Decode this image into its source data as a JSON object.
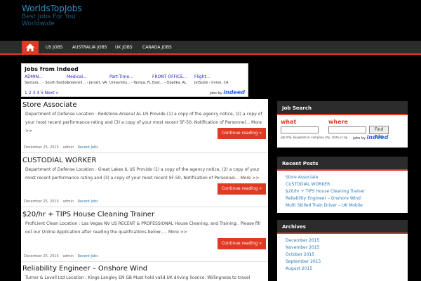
{
  "site": {
    "title": "WorldsTopJobs",
    "description": "Best Jobs For You Worldwide"
  },
  "nav": {
    "items": [
      "US JOBS",
      "AUSTRALIA JOBS",
      "UK JOBS",
      "CANADA JOBS"
    ]
  },
  "indeed_widget": {
    "heading": "Jobs from Indeed",
    "jobs": [
      {
        "title": "ADMIN...",
        "location": "Sentara... - South Boston, VA"
      },
      {
        "title": "Medical...",
        "location": "Greenvill... - Jarratt, VA"
      },
      {
        "title": "Part-Time...",
        "location": "University... - Tampa, FL"
      },
      {
        "title": "FRONT OFFICE...",
        "location": "East... - Opelika, AL"
      },
      {
        "title": "Flight...",
        "location": "JetSuite - Irvine, CA"
      }
    ],
    "pager": "1 2 3 4 5 Next »",
    "jobs_by": "jobs by",
    "brand": "indeed"
  },
  "posts": [
    {
      "title": "Store Associate",
      "excerpt": "Department of Defense Location : Redstone Arsenal AL US Provide (1) a copy of the agency notice, (2) a copy of your most recent performance rating and (3) a copy of your most recent SF-50, Notification of Personnel… More >>",
      "more": "Continue reading »",
      "date": "December 25, 2015",
      "author": "admin",
      "category": "Recent Jobs"
    },
    {
      "title": "CUSTODIAL WORKER",
      "excerpt": "Department of Defense Location : Great Lakes IL US Provide (1) a copy of the agency notice, (2) a copy of your most recent performance rating and (3) a copy of your most recent SF-50, Notification of Personnel… More >>",
      "more": "Continue reading »",
      "date": "December 25, 2015",
      "author": "admin",
      "category": "Recent Jobs"
    },
    {
      "title": "$20/hr + TIPS House Cleaning Trainer",
      "excerpt": "Proficient Clean Location : Las Vegas NV US RECENT & PROFESSIONAL House Cleaning, and Training:. Please fill out our Online Application after reading the qualifications below:…. More >>",
      "more": "Continue reading »",
      "date": "December 25, 2015",
      "author": "admin",
      "category": "Recent Jobs"
    },
    {
      "title": "Reliability Engineer – Onshore Wind",
      "excerpt": "Turner & Lovell Ltd Location : Kings Langley EN GB Must hold valid UK driving licence. Willingness to travel within UK",
      "more": "",
      "date": "",
      "author": "",
      "category": ""
    }
  ],
  "sidebar": {
    "job_search": {
      "title": "Job Search",
      "what": "what",
      "where": "where",
      "find": "Find Jobs",
      "hint": "job title, keywords or company city, state or zip",
      "jobs_by": "jobs by",
      "brand": "indeed"
    },
    "recent_posts": {
      "title": "Recent Posts",
      "items": [
        "Store Associate",
        "CUSTODIAL WORKER",
        "$20/hr + TIPS House Cleaning Trainer",
        "Reliability Engineer – Onshore Wind",
        "Multi Skilled Train Driver – UK Mobile"
      ]
    },
    "archives": {
      "title": "Archives",
      "items": [
        "December 2015",
        "November 2015",
        "October 2015",
        "September 2015",
        "August 2015"
      ]
    }
  }
}
